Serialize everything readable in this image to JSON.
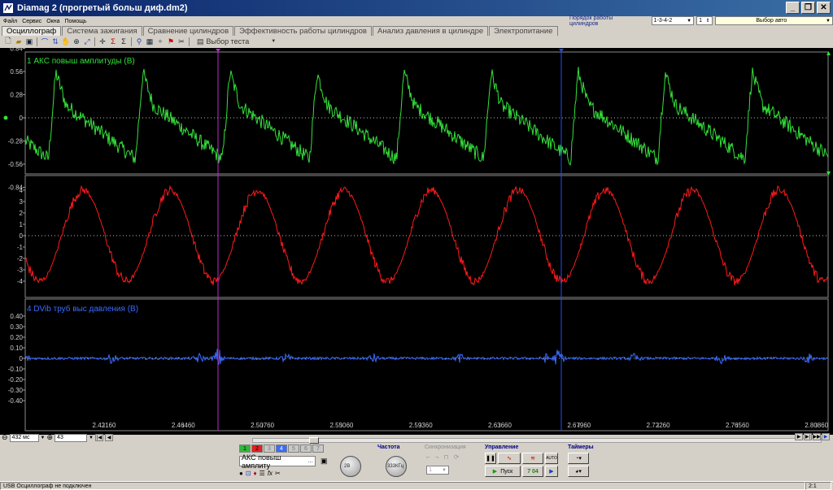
{
  "window": {
    "title": "Diamag 2 (прогретый больш диф.dm2)",
    "min_label": "_",
    "max_label": "❐",
    "close_label": "✕"
  },
  "menu": [
    "Файл",
    "Сервис",
    "Окна",
    "Помощь"
  ],
  "cylinders": {
    "label": "Порядок работы цилиндров",
    "order": "1-3-4-2",
    "count": "1",
    "auto": "Выбор авто"
  },
  "tabs": [
    {
      "label": "Осциллограф",
      "active": true
    },
    {
      "label": "Система зажигания"
    },
    {
      "label": "Сравнение цилиндров"
    },
    {
      "label": "Эффективность работы цилиндров"
    },
    {
      "label": "Анализ давления в цилиндре"
    },
    {
      "label": "Электропитание"
    }
  ],
  "toolbar": {
    "test_select": "Выбор теста",
    "icons": [
      "new-icon",
      "open-icon",
      "save-icon",
      "probe-icon",
      "measure-icon",
      "hand-icon",
      "zoom-icon",
      "auto-scale-icon",
      "cursor-icon",
      "sigma-icon",
      "table-icon",
      "marker-icon",
      "flag-icon",
      "scissors-icon"
    ]
  },
  "channels": [
    {
      "label": "1 АКС повыш амплитуды (В)",
      "color": "#33e23a",
      "yticks": [
        "0.84",
        "0.56",
        "0.28",
        "0",
        "-0.28",
        "-0.56",
        "-0.84"
      ]
    },
    {
      "label": "",
      "color": "#ff1a1a",
      "yticks": [
        "4",
        "3",
        "2",
        "1",
        "0",
        "-1",
        "-2",
        "-3",
        "-4"
      ]
    },
    {
      "label": "4 DVib труб выс давления (В)",
      "color": "#3a6cff",
      "yticks": [
        "0.40",
        "0.30",
        "0.20",
        "0.10",
        "0",
        "-0.10",
        "-0.20",
        "-0.30",
        "-0.40"
      ]
    }
  ],
  "xaxis": {
    "ticks": [
      "2.42160",
      "2.46460",
      "2.50760",
      "2.55060",
      "2.59360",
      "2.63660",
      "2.67960",
      "2.72260",
      "2.76560",
      "2.80860"
    ]
  },
  "cursors": {
    "left_color": "#c02ad0",
    "right_color": "#2050ff"
  },
  "timebase": {
    "span": "432 мс",
    "value": "43"
  },
  "controls": {
    "channel_buttons": [
      "1",
      "2",
      "3",
      "4",
      "5",
      "6",
      "7"
    ],
    "signal": "АКС повыш амплиту",
    "range_knob": "2В",
    "freq_label": "Частота",
    "freq_knob": "333КГц",
    "sync_label": "Синхронизация",
    "sync_value": "1",
    "control_label": "Управление",
    "start": "Пуск",
    "counter": "7 04",
    "auto": "AUTO",
    "timers_label": "Таймеры"
  },
  "status": {
    "left": "USB Осциллограф не подключен",
    "right": "2:1"
  }
}
